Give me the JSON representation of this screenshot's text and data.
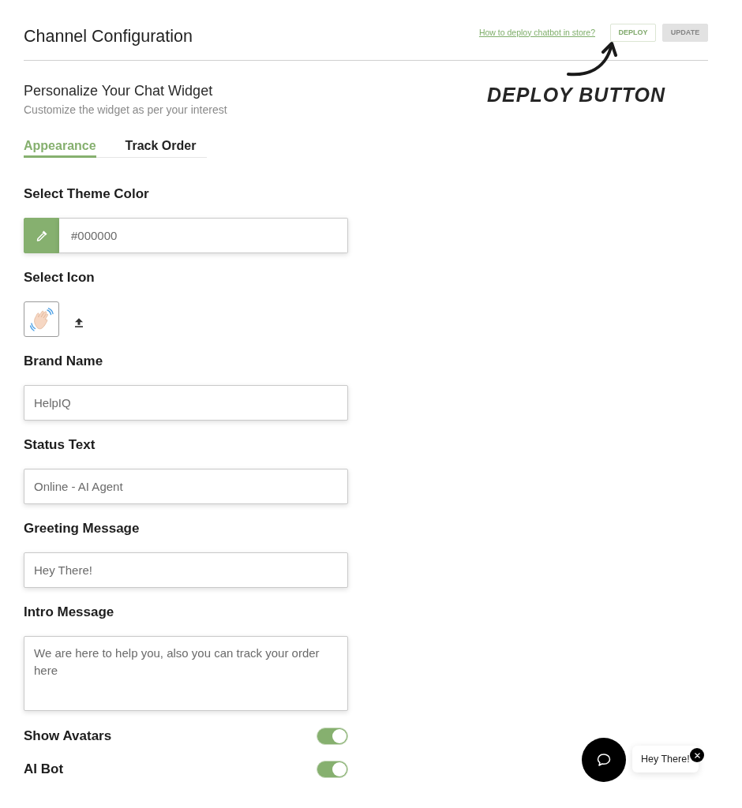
{
  "header": {
    "title": "Channel Configuration",
    "help_link": "How to deploy chatbot in store?",
    "buttons": [
      {
        "label": "DEPLOY",
        "disabled": false
      },
      {
        "label": "UPDATE",
        "disabled": true
      }
    ]
  },
  "annotation": {
    "text": "DEPLOY BUTTON"
  },
  "widget_settings": {
    "title": "Personalize Your Chat Widget",
    "subtitle": "Customize the widget as per your interest"
  },
  "tabs": [
    {
      "label": "Appearance",
      "selected": true
    },
    {
      "label": "Track Order",
      "selected": false
    }
  ],
  "fields": [
    {
      "kind": "color",
      "label": "Select Theme Color",
      "value": "#000000"
    },
    {
      "kind": "icon",
      "label": "Select Icon"
    },
    {
      "kind": "text",
      "label": "Brand Name",
      "value": "HelpIQ"
    },
    {
      "kind": "text",
      "label": "Status Text",
      "value": "Online - AI Agent"
    },
    {
      "kind": "text",
      "label": "Greeting Message",
      "value": "Hey There!"
    },
    {
      "kind": "textarea",
      "label": "Intro Message",
      "value": "We are here to help you, also you can track your order here"
    },
    {
      "kind": "toggle",
      "label": "Show Avatars",
      "on": true
    },
    {
      "kind": "toggle",
      "label": "AI Bot",
      "on": true
    }
  ],
  "chat_preview": {
    "greeting": "Hey There!"
  }
}
